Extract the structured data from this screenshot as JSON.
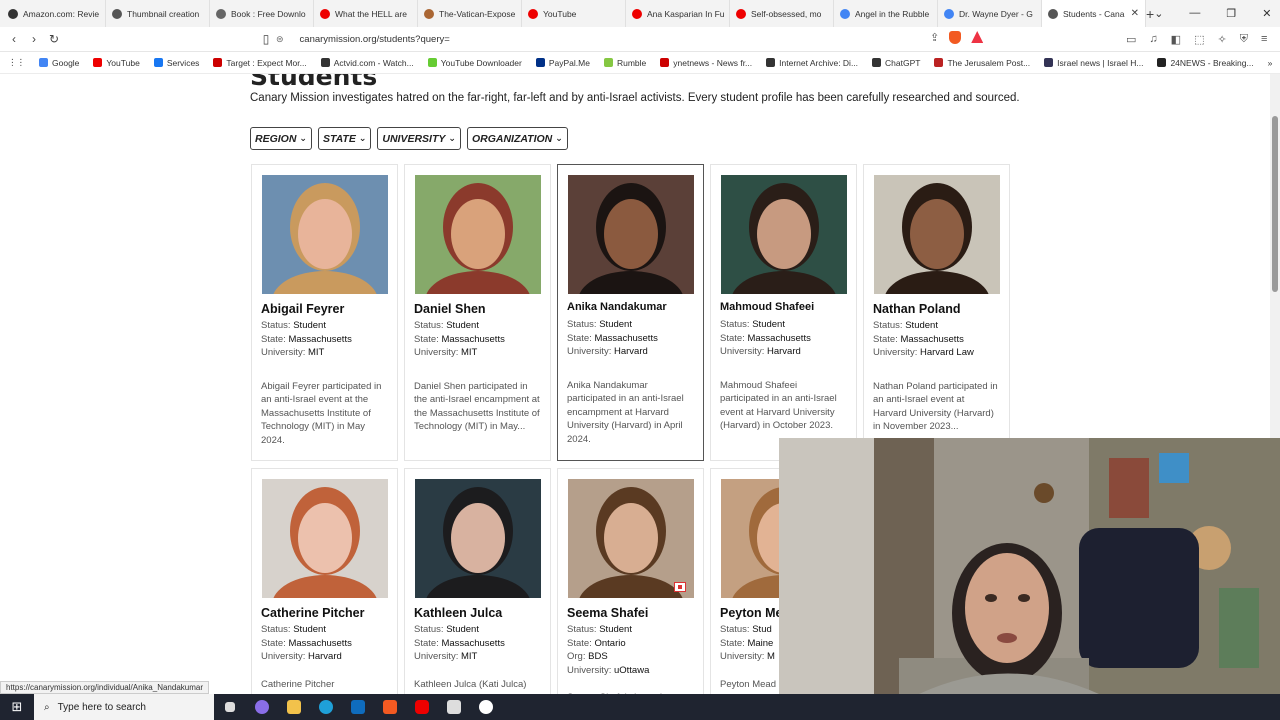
{
  "browser": {
    "tabs": [
      {
        "label": "Amazon.com: Revie",
        "color": "#333"
      },
      {
        "label": "Thumbnail creation",
        "color": "#555"
      },
      {
        "label": "Book : Free Downlo",
        "color": "#666"
      },
      {
        "label": "What the HELL are",
        "color": "#e00"
      },
      {
        "label": "The-Vatican-Expose",
        "color": "#a63"
      },
      {
        "label": "YouTube",
        "color": "#e00"
      },
      {
        "label": "Ana Kasparian In Fu",
        "color": "#e00"
      },
      {
        "label": "Self-obsessed, mo",
        "color": "#e00"
      },
      {
        "label": "Angel in the Rubble",
        "color": "#4285f4"
      },
      {
        "label": "Dr. Wayne Dyer - G",
        "color": "#4285f4"
      },
      {
        "label": "Students - Cana",
        "color": "#555",
        "active": true
      }
    ],
    "url": "canarymission.org/students?query=",
    "bookmarks": [
      {
        "label": "Google",
        "color": "#4285f4"
      },
      {
        "label": "YouTube",
        "color": "#e00"
      },
      {
        "label": "Services",
        "color": "#1877f2"
      },
      {
        "label": "Target : Expect Mor...",
        "color": "#cc0000"
      },
      {
        "label": "Actvid.com - Watch...",
        "color": "#333"
      },
      {
        "label": "YouTube Downloader",
        "color": "#6c3"
      },
      {
        "label": "PayPal.Me",
        "color": "#003087"
      },
      {
        "label": "Rumble",
        "color": "#85c742"
      },
      {
        "label": "ynetnews - News fr...",
        "color": "#c00"
      },
      {
        "label": "Internet Archive: Di...",
        "color": "#333"
      },
      {
        "label": "ChatGPT",
        "color": "#333"
      },
      {
        "label": "The Jerusalem Post...",
        "color": "#b22"
      },
      {
        "label": "Israel news | Israel H...",
        "color": "#335"
      },
      {
        "label": "24NEWS - Breaking...",
        "color": "#222"
      }
    ]
  },
  "page": {
    "heading": "Students",
    "intro": "Canary Mission investigates hatred on the far-right, far-left and by anti-Israel activists. Every student profile has been carefully researched and sourced.",
    "filters": [
      "REGION",
      "STATE",
      "UNIVERSITY",
      "ORGANIZATION"
    ]
  },
  "labels": {
    "status": "Status:",
    "state": "State:",
    "university": "University:",
    "org": "Org:"
  },
  "cards": [
    {
      "name": "Abigail Feyrer",
      "status": "Student",
      "state": "Massachusetts",
      "university": "MIT",
      "desc": "Abigail Feyrer participated in an anti-Israel event at the Massachusetts Institute of Technology (MIT) in May 2024.",
      "bg": "#6d8fb0",
      "skin": "#e8b49a",
      "hair": "#c99a5e"
    },
    {
      "name": "Daniel Shen",
      "status": "Student",
      "state": "Massachusetts",
      "university": "MIT",
      "desc": "Daniel Shen participated in the anti-Israel encampment at the Massachusetts Institute of Technology (MIT) in May...",
      "bg": "#86a96a",
      "skin": "#d9a27b",
      "hair": "#8b3a2c"
    },
    {
      "name": "Anika Nandakumar",
      "status": "Student",
      "state": "Massachusetts",
      "university": "Harvard",
      "desc": "Anika Nandakumar participated in an anti-Israel encampment at Harvard University (Harvard) in April 2024.",
      "bg": "#5b4038",
      "skin": "#8b5a3f",
      "hair": "#1b1412"
    },
    {
      "name": "Mahmoud Shafeei",
      "status": "Student",
      "state": "Massachusetts",
      "university": "Harvard",
      "desc": "Mahmoud Shafeei participated in an anti-Israel event at Harvard University (Harvard) in October 2023.",
      "bg": "#2e4f45",
      "skin": "#c79a80",
      "hair": "#2a1e18"
    },
    {
      "name": "Nathan Poland",
      "status": "Student",
      "state": "Massachusetts",
      "university": "Harvard Law",
      "desc": "Nathan Poland participated in an anti-Israel event at Harvard University (Harvard) in November 2023...",
      "bg": "#c9c4b8",
      "skin": "#8d5e43",
      "hair": "#2a1c14"
    },
    {
      "name": "Catherine Pitcher",
      "status": "Student",
      "state": "Massachusetts",
      "university": "Harvard",
      "desc": "Catherine Pitcher",
      "bg": "#d7d2cc",
      "skin": "#ecc1ad",
      "hair": "#c0623a"
    },
    {
      "name": "Kathleen Julca",
      "status": "Student",
      "state": "Massachusetts",
      "university": "MIT",
      "desc": "Kathleen Julca (Kati Julca)",
      "bg": "#2a3b44",
      "skin": "#d8b2a0",
      "hair": "#1c1c1e"
    },
    {
      "name": "Seema Shafei",
      "status": "Student",
      "state": "Ontario",
      "org": "BDS",
      "university": "uOttawa",
      "desc": "Seema Shafei showed",
      "bg": "#b59f8b",
      "skin": "#d8ae92",
      "hair": "#5a3a22"
    },
    {
      "name": "Peyton Me",
      "status": "Stud",
      "state": "Maine",
      "university": "M",
      "desc": "Peyton Mead",
      "bg": "#c4a081",
      "skin": "#e2b394",
      "hair": "#a06a3c"
    }
  ],
  "status_url": "https://canarymission.org/individual/Anika_Nandakumar",
  "taskbar": {
    "search_placeholder": "Type here to search"
  }
}
